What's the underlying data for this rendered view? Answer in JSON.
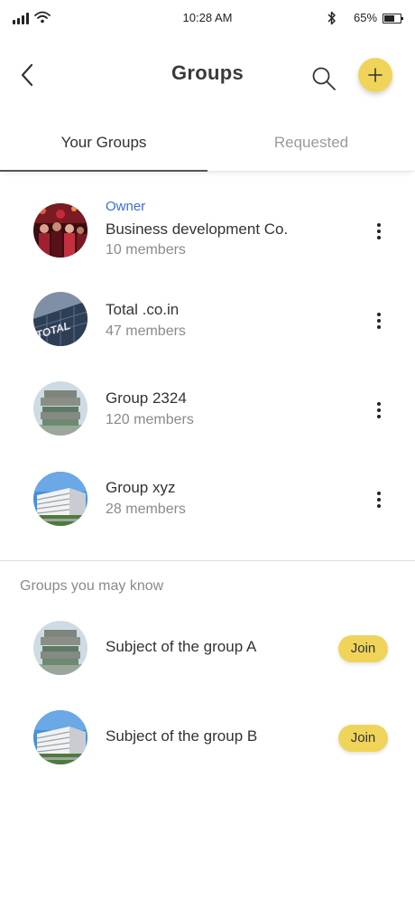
{
  "status_bar": {
    "time": "10:28 AM",
    "battery_percent": "65%",
    "battery_level": 0.65,
    "icons": [
      "signal-icon",
      "wifi-icon",
      "bluetooth-icon",
      "battery-icon"
    ]
  },
  "header": {
    "title": "Groups",
    "back_icon": "back-arrow-icon",
    "search_icon": "search-icon",
    "add_icon": "plus-icon",
    "accent_color": "#f0d45a"
  },
  "tabs": [
    {
      "label": "Your Groups",
      "active": true
    },
    {
      "label": "Requested",
      "active": false
    }
  ],
  "groups": [
    {
      "role": "Owner",
      "name": "Business development Co.",
      "members": "10 members",
      "avatar": "crowd-photo"
    },
    {
      "name": "Total .co.in",
      "members": "47 members",
      "avatar": "total-building-photo"
    },
    {
      "name": "Group 2324",
      "members": "120 members",
      "avatar": "modern-building-photo"
    },
    {
      "name": "Group xyz",
      "members": "28 members",
      "avatar": "office-building-photo"
    }
  ],
  "suggestions": {
    "title": "Groups you may know",
    "items": [
      {
        "name": "Subject of the group A",
        "join_label": "Join",
        "avatar": "modern-building-photo"
      },
      {
        "name": "Subject of the group B",
        "join_label": "Join",
        "avatar": "office-building-photo"
      }
    ]
  },
  "colors": {
    "owner_label": "#3b6fd4",
    "join_button": "#f0d45a",
    "muted_text": "#8a8a8a"
  }
}
